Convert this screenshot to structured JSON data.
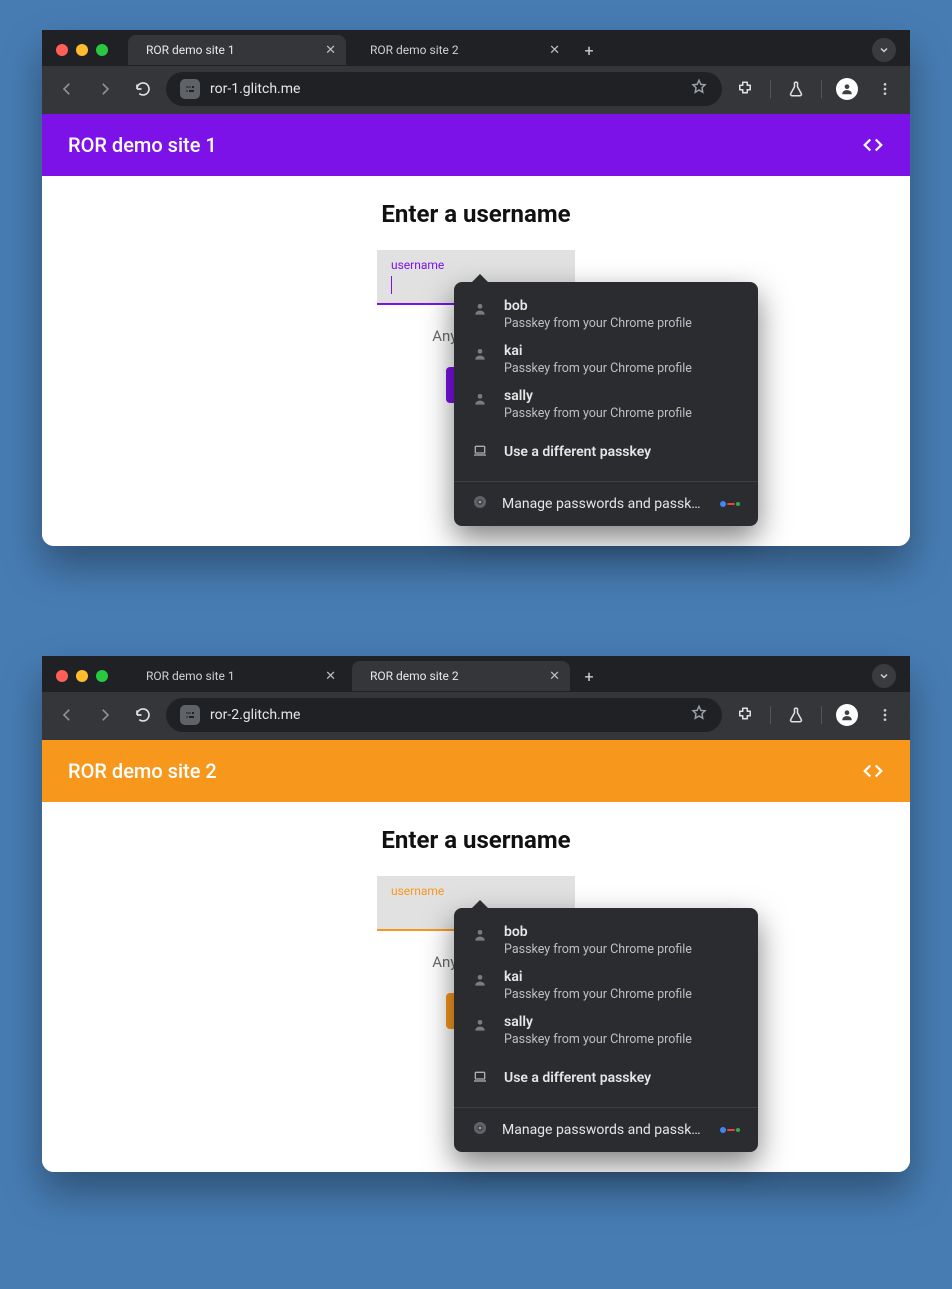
{
  "windows": [
    {
      "id": "w1",
      "accent": "purple",
      "accentColor": "#7c12e8",
      "tabs": [
        {
          "title": "ROR demo site 1",
          "active": true
        },
        {
          "title": "ROR demo site 2",
          "active": false
        }
      ],
      "url": "ror-1.glitch.me",
      "appTitle": "ROR demo site 1",
      "heading": "Enter a username",
      "fieldLabel": "username",
      "fieldValue": "",
      "helper": "Any usernam",
      "showCaret": true
    },
    {
      "id": "w2",
      "accent": "orange",
      "accentColor": "#f7981d",
      "tabs": [
        {
          "title": "ROR demo site 1",
          "active": false
        },
        {
          "title": "ROR demo site 2",
          "active": true
        }
      ],
      "url": "ror-2.glitch.me",
      "appTitle": "ROR demo site 2",
      "heading": "Enter a username",
      "fieldLabel": "username",
      "fieldValue": "",
      "helper": "Any usernam",
      "showCaret": false
    }
  ],
  "passkeyPopup": {
    "suggestions": [
      {
        "name": "bob",
        "sub": "Passkey from your Chrome profile"
      },
      {
        "name": "kai",
        "sub": "Passkey from your Chrome profile"
      },
      {
        "name": "sally",
        "sub": "Passkey from your Chrome profile"
      }
    ],
    "altLabel": "Use a different passkey",
    "footerLabel": "Manage passwords and passkeys…"
  }
}
